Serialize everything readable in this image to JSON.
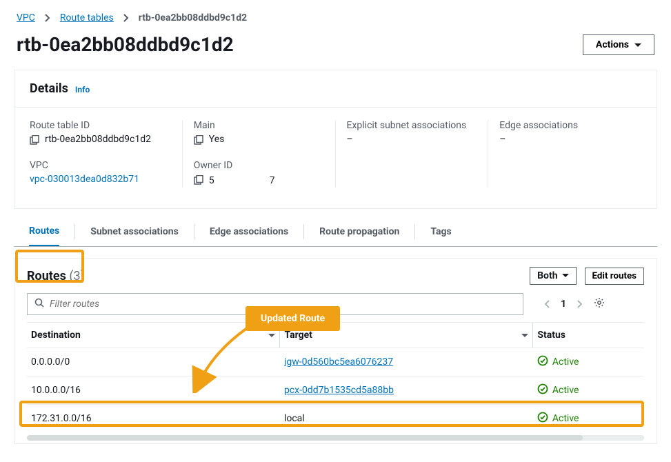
{
  "breadcrumb": {
    "vpc": "VPC",
    "routeTables": "Route tables",
    "current": "rtb-0ea2bb08ddbd9c1d2"
  },
  "page": {
    "title": "rtb-0ea2bb08ddbd9c1d2",
    "actions": "Actions"
  },
  "details": {
    "heading": "Details",
    "info": "Info",
    "routeTableId": {
      "label": "Route table ID",
      "value": "rtb-0ea2bb08ddbd9c1d2"
    },
    "vpc": {
      "label": "VPC",
      "value": "vpc-030013dea0d832b71"
    },
    "main": {
      "label": "Main",
      "value": "Yes"
    },
    "ownerId": {
      "label": "Owner ID",
      "prefix": "5",
      "suffix": "7"
    },
    "explicitSubnet": {
      "label": "Explicit subnet associations",
      "value": "–"
    },
    "edgeAssociations": {
      "label": "Edge associations",
      "value": "–"
    }
  },
  "tabs": {
    "routes": "Routes",
    "subnetAssociations": "Subnet associations",
    "edgeAssociations": "Edge associations",
    "routePropagation": "Route propagation",
    "tags": "Tags"
  },
  "routesPanel": {
    "title": "Routes",
    "count": "(3)",
    "selector": "Both",
    "editRoutes": "Edit routes",
    "filterPlaceholder": "Filter routes",
    "page": "1",
    "columns": {
      "destination": "Destination",
      "target": "Target",
      "status": "Status"
    },
    "rows": [
      {
        "destination": "0.0.0.0/0",
        "target": "igw-0d560bc5ea6076237",
        "targetLink": true,
        "status": "Active"
      },
      {
        "destination": "10.0.0.0/16",
        "target": "pcx-0dd7b1535cd5a88bb",
        "targetLink": true,
        "status": "Active"
      },
      {
        "destination": "172.31.0.0/16",
        "target": "local",
        "targetLink": false,
        "status": "Active"
      }
    ]
  },
  "annotation": {
    "label": "Updated Route"
  }
}
